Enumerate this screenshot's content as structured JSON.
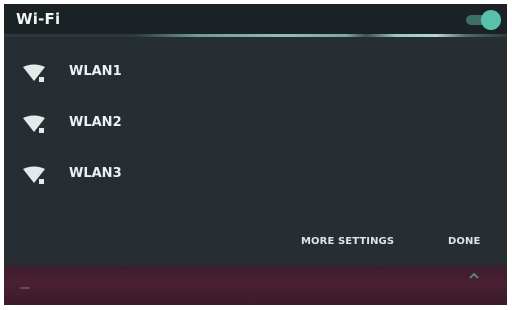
{
  "dialog": {
    "title": "Wi-Fi",
    "wifi_enabled": true
  },
  "networks": [
    {
      "name": "WLAN1",
      "icon": "wifi-icon"
    },
    {
      "name": "WLAN2",
      "icon": "wifi-icon"
    },
    {
      "name": "WLAN3",
      "icon": "wifi-icon"
    }
  ],
  "actions": {
    "more_settings": "MORE SETTINGS",
    "done": "DONE"
  },
  "colors": {
    "panel_background": "#262e33",
    "title_bar": "#1b2226",
    "accent": "#58c1ac",
    "navigation_bar": "#4a1f33"
  }
}
